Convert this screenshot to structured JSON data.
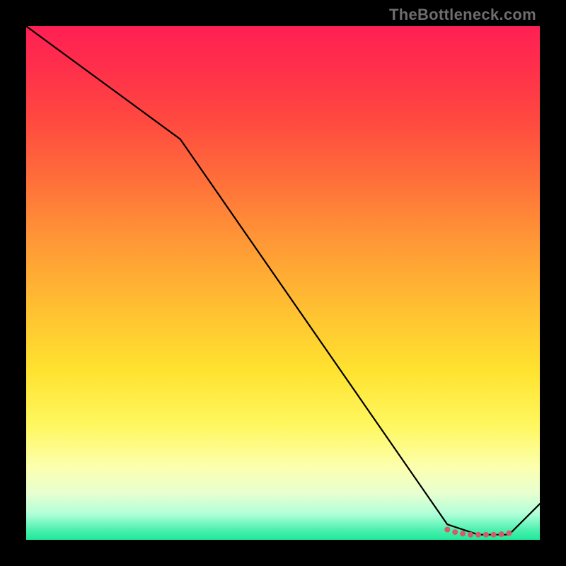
{
  "watermark": "TheBottleneck.com",
  "chart_data": {
    "type": "line",
    "title": "",
    "xlabel": "",
    "ylabel": "",
    "xlim": [
      0,
      100
    ],
    "ylim": [
      0,
      100
    ],
    "grid": false,
    "legend": false,
    "series": [
      {
        "name": "curve",
        "x": [
          0,
          30,
          82,
          88,
          94,
          100
        ],
        "values": [
          100,
          78,
          3,
          1,
          1,
          7
        ]
      }
    ],
    "markers": {
      "name": "dots",
      "x": [
        82,
        83.5,
        85,
        86.5,
        88,
        89.5,
        91,
        92.5,
        94
      ],
      "values": [
        2.0,
        1.5,
        1.2,
        1.0,
        1.0,
        1.0,
        1.0,
        1.1,
        1.3
      ],
      "color": "#d65b68",
      "radius": 4
    },
    "colors": {
      "line": "#000000",
      "marker": "#d65b68"
    }
  }
}
